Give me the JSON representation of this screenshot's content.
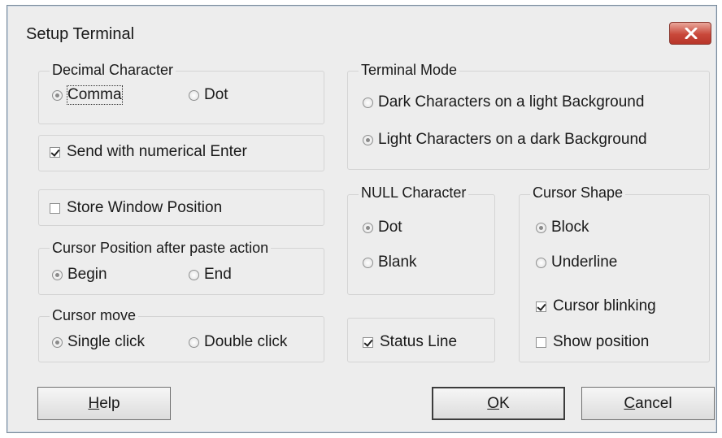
{
  "window": {
    "title": "Setup Terminal"
  },
  "decimal": {
    "label": "Decimal Character",
    "comma": "Comma",
    "dot": "Dot",
    "selected": "comma"
  },
  "send_enter": {
    "label": "Send with numerical Enter",
    "checked": true
  },
  "store_position": {
    "label": "Store Window Position",
    "checked": false
  },
  "paste": {
    "label": "Cursor Position after paste action",
    "begin": "Begin",
    "end": "End",
    "selected": "begin"
  },
  "cursor_move": {
    "label": "Cursor move",
    "single": "Single click",
    "double": "Double click",
    "selected": "single"
  },
  "terminal_mode": {
    "label": "Terminal Mode",
    "dark": "Dark Characters on a light Background",
    "light": "Light Characters on a dark Background",
    "selected": "light"
  },
  "null_char": {
    "label": "NULL Character",
    "dot": "Dot",
    "blank": "Blank",
    "selected": "dot"
  },
  "cursor_shape": {
    "label": "Cursor Shape",
    "block": "Block",
    "underline": "Underline",
    "selected": "block",
    "blinking": "Cursor blinking",
    "blinking_checked": true,
    "show_position": "Show position",
    "show_position_checked": false
  },
  "status_line": {
    "label": "Status Line",
    "checked": true
  },
  "buttons": {
    "help_mnemonic": "H",
    "help_rest": "elp",
    "ok_mnemonic": "O",
    "ok_rest": "K",
    "cancel_mnemonic": "C",
    "cancel_rest": "ancel"
  },
  "colors": {
    "dialog_bg": "#ededed",
    "close_button": "#c9483a"
  },
  "icons": {
    "close": "close-icon"
  }
}
